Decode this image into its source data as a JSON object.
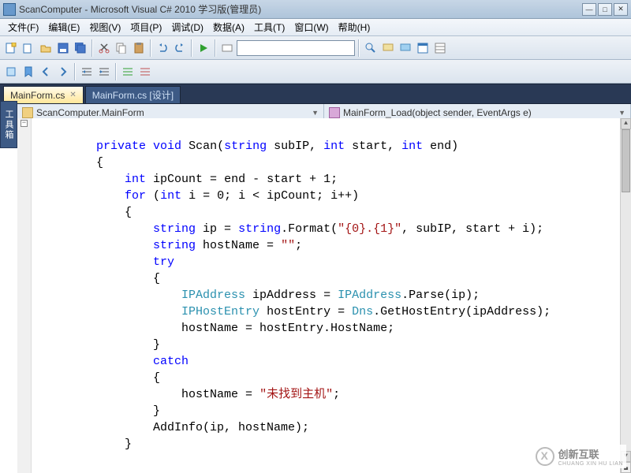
{
  "window": {
    "title": "ScanComputer - Microsoft Visual C# 2010 学习版(管理员)"
  },
  "menu": {
    "file": "文件(F)",
    "edit": "编辑(E)",
    "view": "视图(V)",
    "project": "项目(P)",
    "debug": "调试(D)",
    "data": "数据(A)",
    "tools": "工具(T)",
    "window": "窗口(W)",
    "help": "帮助(H)"
  },
  "tabs": {
    "active": "MainForm.cs",
    "design": "MainForm.cs [设计]"
  },
  "sidebar": {
    "toolbox": "工具箱"
  },
  "nav": {
    "class": "ScanComputer.MainForm",
    "member": "MainForm_Load(object sender, EventArgs e)"
  },
  "watermark": {
    "line1": "创新互联",
    "line2": "CHUANG XIN HU LIAN"
  },
  "code": {
    "l1a": "private",
    "l1b": "void",
    "l1c": " Scan(",
    "l1d": "string",
    "l1e": " subIP, ",
    "l1f": "int",
    "l1g": " start, ",
    "l1h": "int",
    "l1i": " end)",
    "l2": "{",
    "l3a": "int",
    "l3b": " ipCount = end - start + 1;",
    "l4a": "for",
    "l4b": " (",
    "l4c": "int",
    "l4d": " i = 0; i < ipCount; i++)",
    "l5": "{",
    "l6a": "string",
    "l6b": " ip = ",
    "l6c": "string",
    "l6d": ".Format(",
    "l6e": "\"{0}.{1}\"",
    "l6f": ", subIP, start + i);",
    "l7a": "string",
    "l7b": " hostName = ",
    "l7c": "\"\"",
    "l7d": ";",
    "l8": "try",
    "l9": "{",
    "l10a": "IPAddress",
    "l10b": " ipAddress = ",
    "l10c": "IPAddress",
    "l10d": ".Parse(ip);",
    "l11a": "IPHostEntry",
    "l11b": " hostEntry = ",
    "l11c": "Dns",
    "l11d": ".GetHostEntry(ipAddress);",
    "l12": "hostName = hostEntry.HostName;",
    "l13": "}",
    "l14": "catch",
    "l15": "{",
    "l16a": "hostName = ",
    "l16b": "\"未找到主机\"",
    "l16c": ";",
    "l17": "}",
    "l18": "AddInfo(ip, hostName);",
    "l19": "}"
  }
}
